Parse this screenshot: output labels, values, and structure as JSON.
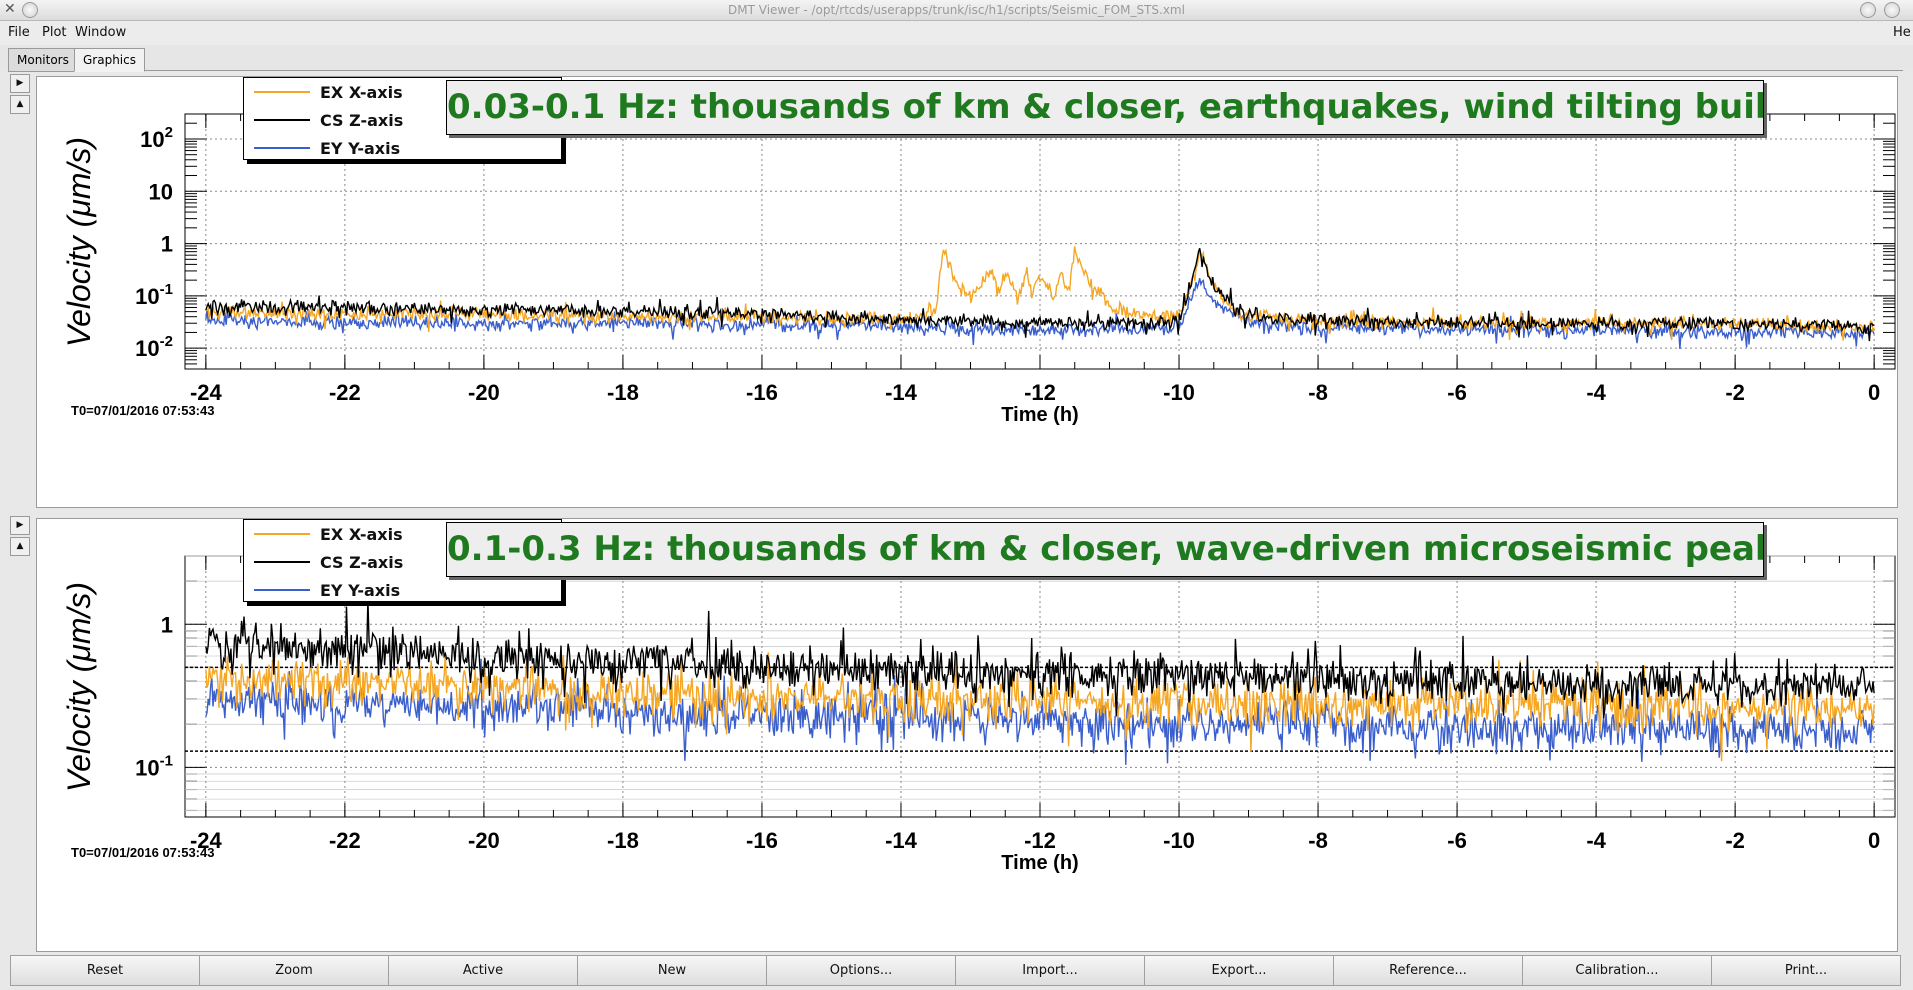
{
  "window": {
    "title": "DMT Viewer - /opt/rtcds/userapps/trunk/isc/h1/scripts/Seismic_FOM_STS.xml"
  },
  "menu": {
    "file": "File",
    "plot": "Plot",
    "window": "Window",
    "help": "He"
  },
  "tabs": [
    {
      "label": "Monitors"
    },
    {
      "label": "Graphics"
    }
  ],
  "panels": [
    {
      "title": "0.03-0.1 Hz: thousands of km & closer, earthquakes, wind tilting building",
      "t0": "T0=07/01/2016 07:53:43",
      "legend": [
        {
          "label": "EX X-axis",
          "color": "#f5a623"
        },
        {
          "label": "CS Z-axis",
          "color": "#000000"
        },
        {
          "label": "EY Y-axis",
          "color": "#3a5fcd"
        }
      ]
    },
    {
      "title": "0.1-0.3 Hz: thousands of km & closer, wave-driven microseismic peak",
      "t0": "T0=07/01/2016 07:53:43",
      "legend": [
        {
          "label": "EX X-axis",
          "color": "#f5a623"
        },
        {
          "label": "CS Z-axis",
          "color": "#000000"
        },
        {
          "label": "EY Y-axis",
          "color": "#3a5fcd"
        }
      ]
    }
  ],
  "chart_data": [
    {
      "type": "line",
      "title": "0.03-0.1 Hz: thousands of km & closer, earthquakes, wind tilting building",
      "xlabel": "Time (h)",
      "ylabel": "Velocity  (μm/s)",
      "xlim": [
        -24.3,
        0.3
      ],
      "ylim": [
        0.004,
        300
      ],
      "yscale": "log",
      "grid": true,
      "legend_position": "top-left",
      "xticks": [
        "-24",
        "-22",
        "-20",
        "-18",
        "-16",
        "-14",
        "-12",
        "-10",
        "-8",
        "-6",
        "-4",
        "-2",
        "0"
      ],
      "yticks": [
        {
          "value": 0.01,
          "base": "10",
          "exp": "-2"
        },
        {
          "value": 0.1,
          "base": "10",
          "exp": "-1"
        },
        {
          "value": 1,
          "base": "1",
          "exp": ""
        },
        {
          "value": 10,
          "base": "10",
          "exp": ""
        },
        {
          "value": 100,
          "base": "10",
          "exp": "2"
        }
      ],
      "series": [
        {
          "name": "EX X-axis",
          "color": "#f5a623",
          "x": [
            -24,
            -22,
            -20,
            -18,
            -16,
            -14,
            -13.5,
            -13.4,
            -13.3,
            -13.2,
            -13,
            -12.7,
            -12.6,
            -12.5,
            -12.3,
            -12.2,
            -12.1,
            -12,
            -11.8,
            -11.7,
            -11.6,
            -11.5,
            -11.3,
            -11.1,
            -11,
            -10.5,
            -10,
            -9.8,
            -9.7,
            -9.5,
            -9.2,
            -9,
            -8,
            -6,
            -4,
            -2,
            0
          ],
          "values": [
            0.05,
            0.045,
            0.045,
            0.04,
            0.04,
            0.035,
            0.05,
            0.85,
            0.35,
            0.15,
            0.1,
            0.3,
            0.11,
            0.28,
            0.09,
            0.35,
            0.12,
            0.25,
            0.1,
            0.32,
            0.12,
            0.75,
            0.2,
            0.1,
            0.06,
            0.04,
            0.04,
            0.2,
            0.7,
            0.15,
            0.05,
            0.04,
            0.035,
            0.03,
            0.03,
            0.03,
            0.025
          ]
        },
        {
          "name": "CS Z-axis",
          "color": "#000000",
          "x": [
            -24,
            -22,
            -20,
            -18,
            -16,
            -14,
            -12,
            -11,
            -10.5,
            -10,
            -9.8,
            -9.7,
            -9.5,
            -9.2,
            -9,
            -8,
            -6,
            -4,
            -2,
            0
          ],
          "values": [
            0.06,
            0.06,
            0.055,
            0.05,
            0.045,
            0.035,
            0.03,
            0.03,
            0.03,
            0.035,
            0.25,
            0.75,
            0.15,
            0.06,
            0.04,
            0.035,
            0.03,
            0.03,
            0.03,
            0.025
          ]
        },
        {
          "name": "EY Y-axis",
          "color": "#3a5fcd",
          "x": [
            -24,
            -22,
            -20,
            -18,
            -16,
            -14,
            -12,
            -10,
            -9.7,
            -9.5,
            -9,
            -8,
            -6,
            -4,
            -2,
            0
          ],
          "values": [
            0.035,
            0.03,
            0.03,
            0.03,
            0.028,
            0.025,
            0.022,
            0.025,
            0.2,
            0.08,
            0.03,
            0.025,
            0.022,
            0.022,
            0.02,
            0.02
          ]
        }
      ]
    },
    {
      "type": "line",
      "title": "0.1-0.3 Hz: thousands of km & closer, wave-driven microseismic peak",
      "xlabel": "Time (h)",
      "ylabel": "Velocity  (μm/s)",
      "xlim": [
        -24.3,
        0.3
      ],
      "ylim": [
        0.045,
        3
      ],
      "yscale": "log",
      "grid": true,
      "legend_position": "top-left",
      "xticks": [
        "-24",
        "-22",
        "-20",
        "-18",
        "-16",
        "-14",
        "-12",
        "-10",
        "-8",
        "-6",
        "-4",
        "-2",
        "0"
      ],
      "yticks": [
        {
          "value": 0.1,
          "base": "10",
          "exp": "-1"
        },
        {
          "value": 1,
          "base": "1",
          "exp": ""
        }
      ],
      "series": [
        {
          "name": "EX X-axis",
          "color": "#f5a623",
          "x": [
            -24,
            -22,
            -20,
            -18,
            -16,
            -14,
            -12,
            -10,
            -8,
            -6,
            -4,
            -2,
            0
          ],
          "values": [
            0.42,
            0.4,
            0.37,
            0.33,
            0.3,
            0.3,
            0.29,
            0.28,
            0.27,
            0.27,
            0.26,
            0.26,
            0.25
          ]
        },
        {
          "name": "CS Z-axis",
          "color": "#000000",
          "x": [
            -24,
            -22,
            -20,
            -18,
            -16,
            -14,
            -12,
            -10,
            -8,
            -6,
            -4,
            -2,
            0
          ],
          "values": [
            0.75,
            0.68,
            0.6,
            0.55,
            0.5,
            0.47,
            0.45,
            0.43,
            0.42,
            0.4,
            0.39,
            0.38,
            0.37
          ]
        },
        {
          "name": "EY Y-axis",
          "color": "#3a5fcd",
          "x": [
            -24,
            -22,
            -20,
            -18,
            -16,
            -14,
            -12,
            -10,
            -8,
            -6,
            -4,
            -2,
            0
          ],
          "values": [
            0.3,
            0.28,
            0.26,
            0.25,
            0.23,
            0.22,
            0.21,
            0.2,
            0.2,
            0.19,
            0.19,
            0.18,
            0.18
          ]
        }
      ]
    }
  ],
  "toolbar": {
    "buttons": [
      {
        "label": "Reset"
      },
      {
        "label": "Zoom"
      },
      {
        "label": "Active"
      },
      {
        "label": "New"
      },
      {
        "label": "Options..."
      },
      {
        "label": "Import..."
      },
      {
        "label": "Export..."
      },
      {
        "label": "Reference..."
      },
      {
        "label": "Calibration..."
      },
      {
        "label": "Print..."
      }
    ]
  }
}
